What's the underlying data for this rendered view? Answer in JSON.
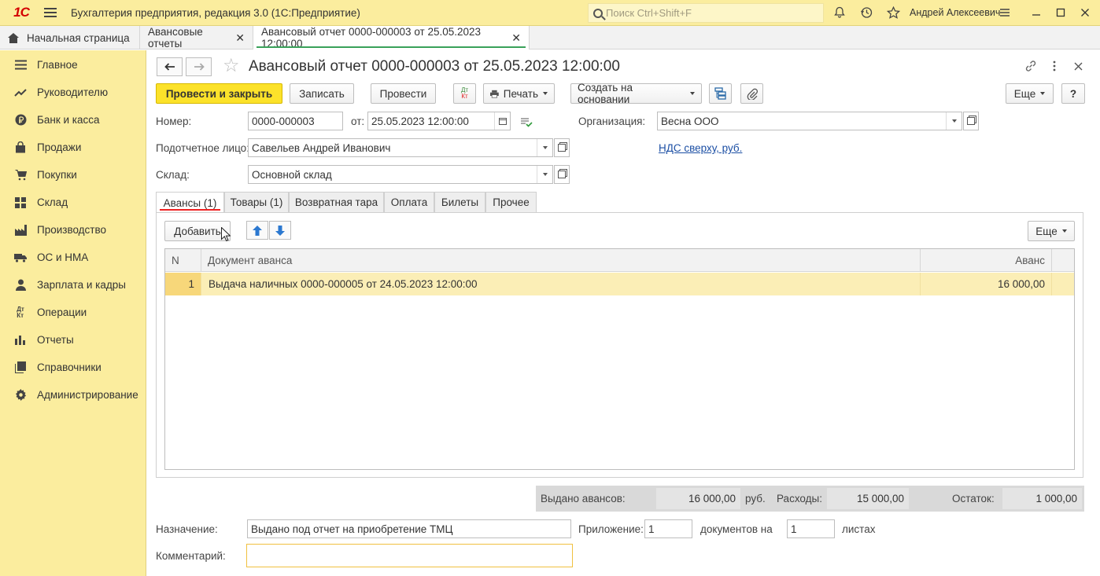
{
  "titlebar": {
    "logo": "1С",
    "app_title": "Бухгалтерия предприятия, редакция 3.0  (1С:Предприятие)",
    "search_placeholder": "Поиск Ctrl+Shift+F",
    "user_name": "Андрей Алексеевич",
    "icons": [
      "bell-icon",
      "history-icon",
      "star-icon",
      "settings-menu-icon"
    ]
  },
  "window_tabs": [
    {
      "label": "Начальная страница",
      "closable": false
    },
    {
      "label": "Авансовые отчеты",
      "closable": true
    },
    {
      "label": "Авансовый отчет 0000-000003 от 25.05.2023 12:00:00",
      "closable": true,
      "active": true
    }
  ],
  "sidebar": {
    "items": [
      {
        "label": "Главное",
        "icon": "menu-lines-icon"
      },
      {
        "label": "Руководителю",
        "icon": "trend-icon"
      },
      {
        "label": "Банк и касса",
        "icon": "ruble-icon"
      },
      {
        "label": "Продажи",
        "icon": "bag-icon"
      },
      {
        "label": "Покупки",
        "icon": "cart-icon"
      },
      {
        "label": "Склад",
        "icon": "grid-icon"
      },
      {
        "label": "Производство",
        "icon": "factory-icon"
      },
      {
        "label": "ОС и НМА",
        "icon": "truck-icon"
      },
      {
        "label": "Зарплата и кадры",
        "icon": "person-icon"
      },
      {
        "label": "Операции",
        "icon": "dt-kt-icon"
      },
      {
        "label": "Отчеты",
        "icon": "bar-chart-icon"
      },
      {
        "label": "Справочники",
        "icon": "books-icon"
      },
      {
        "label": "Администрирование",
        "icon": "gear-icon"
      }
    ]
  },
  "document": {
    "title": "Авансовый отчет 0000-000003 от 25.05.2023 12:00:00",
    "toolbar": {
      "post_close": "Провести и закрыть",
      "save": "Записать",
      "post": "Провести",
      "dtkt": "ДтКт",
      "print": "Печать",
      "create_based": "Создать на основании",
      "more": "Еще",
      "help": "?"
    },
    "fields": {
      "number_label": "Номер:",
      "number_value": "0000-000003",
      "date_label": "от:",
      "date_value": "25.05.2023 12:00:00",
      "org_label": "Организация:",
      "org_value": "Весна ООО",
      "person_label": "Подотчетное лицо:",
      "person_value": "Савельев Андрей Иванович",
      "vat_link": "НДС сверху, руб.",
      "warehouse_label": "Склад:",
      "warehouse_value": "Основной склад"
    },
    "tabs": [
      {
        "label": "Авансы (1)",
        "active": true
      },
      {
        "label": "Товары (1)"
      },
      {
        "label": "Возвратная тара"
      },
      {
        "label": "Оплата"
      },
      {
        "label": "Билеты"
      },
      {
        "label": "Прочее"
      }
    ],
    "table": {
      "add_button": "Добавить",
      "more_button": "Еще",
      "columns": [
        "N",
        "Документ аванса",
        "Аванс"
      ],
      "rows": [
        {
          "n": "1",
          "doc": "Выдача наличных 0000-000005 от 24.05.2023 12:00:00",
          "amount": "16 000,00"
        }
      ]
    },
    "totals": {
      "issued_label": "Выдано авансов:",
      "issued_value": "16 000,00",
      "currency": "руб.",
      "expenses_label": "Расходы:",
      "expenses_value": "15 000,00",
      "balance_label": "Остаток:",
      "balance_value": "1 000,00"
    },
    "footer": {
      "purpose_label": "Назначение:",
      "purpose_value": "Выдано под отчет на приобретение ТМЦ",
      "attachment_label": "Приложение:",
      "attachment_value": "1",
      "documents_on_label": "документов на",
      "sheets_value": "1",
      "sheets_label": "листах",
      "comment_label": "Комментарий:",
      "comment_value": ""
    }
  },
  "colors": {
    "titlebar_bg": "#fbed9e",
    "sidebar_bg": "#fbed9e",
    "primary_button": "#fce22a",
    "selected_row": "#fbeeb6",
    "active_tab_underline": "#ee2222",
    "link": "#1c4fa4"
  }
}
